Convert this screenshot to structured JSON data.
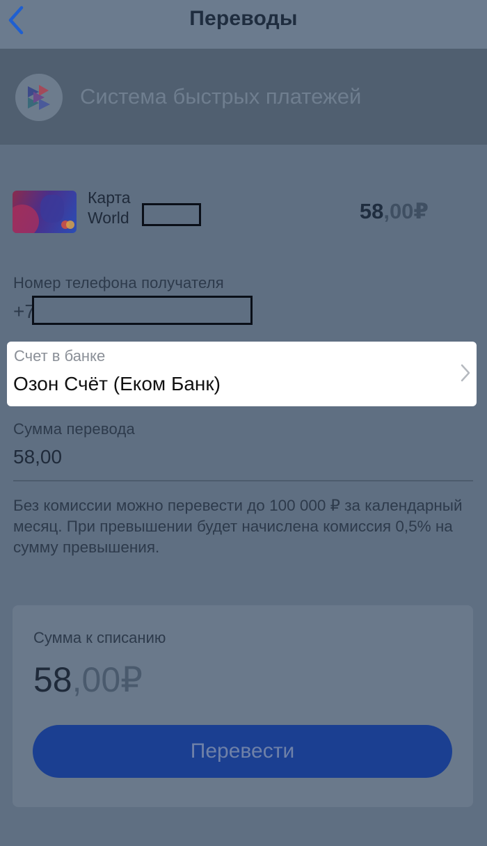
{
  "header": {
    "title": "Переводы"
  },
  "sbp": {
    "label": "Система быстрых платежей"
  },
  "card": {
    "line1": "Карта",
    "line2": "World",
    "balance_int": "58",
    "balance_dec": ",00₽"
  },
  "phone": {
    "label": "Номер телефона получателя",
    "value_prefix": "+7"
  },
  "bank": {
    "label": "Счет в банке",
    "value": "Озон Счёт (Еком Банк)"
  },
  "amount": {
    "label": "Сумма перевода",
    "value": "58,00"
  },
  "hint": "Без комиссии можно перевести до 100 000 ₽ за календарный месяц. При превышении будет начислена комиссия 0,5% на сумму превышения.",
  "summary": {
    "label": "Сумма к списанию",
    "amount_int": "58",
    "amount_dec": ",00₽"
  },
  "button": {
    "label": "Перевести"
  },
  "colors": {
    "accent": "#1b3f91",
    "back": "#1f5fd0"
  }
}
